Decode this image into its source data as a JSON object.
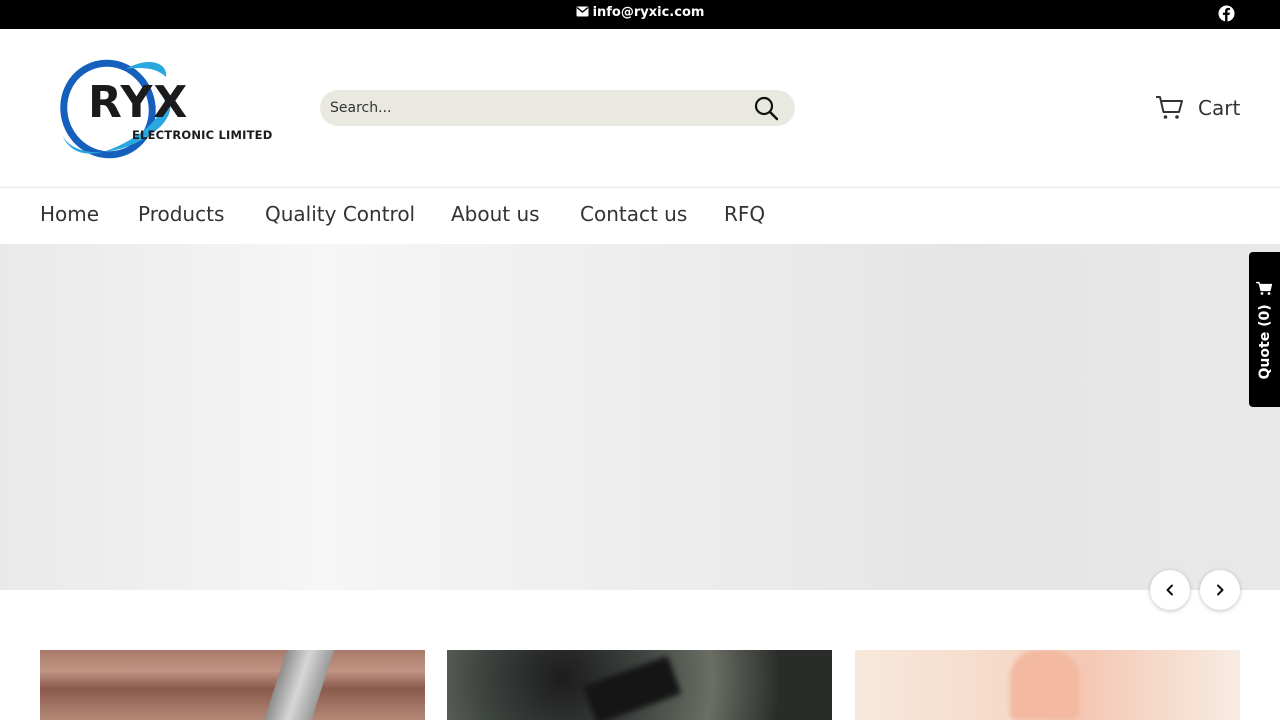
{
  "topbar": {
    "email": "info@ryxic.com",
    "social_icon": "facebook-icon"
  },
  "logo": {
    "wordmark": "RYX",
    "subtitle": "ELECTRONIC LIMITED",
    "accent_colors": [
      "#1560bd",
      "#29a8e0"
    ]
  },
  "search": {
    "placeholder": "Search..."
  },
  "cart": {
    "label": "Cart"
  },
  "nav": {
    "items": [
      "Home",
      "Products",
      "Quality Control",
      "About us",
      "Contact us",
      "RFQ"
    ]
  },
  "quote_tab": {
    "label": "Quote (0)"
  },
  "colors": {
    "topbar_bg": "#000000",
    "search_bg": "#eae9e1",
    "text": "#333333"
  }
}
